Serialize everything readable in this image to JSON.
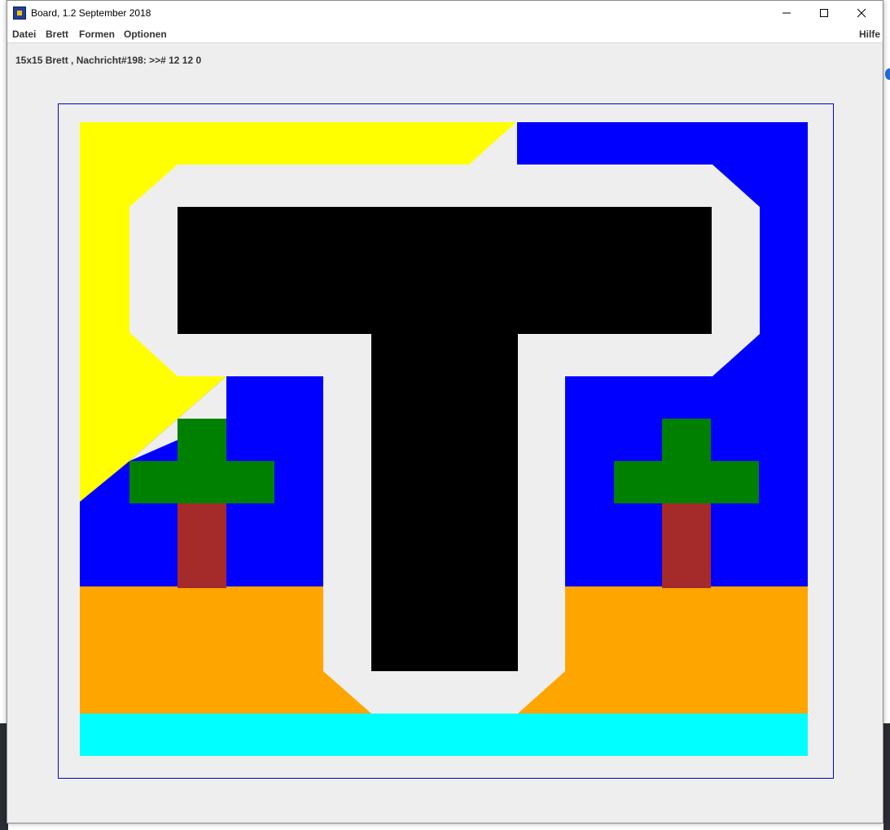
{
  "window": {
    "title": "Board, 1.2 September 2018",
    "icon": "board-app-icon",
    "controls": [
      "minimize-icon",
      "maximize-icon",
      "close-icon"
    ]
  },
  "menu": {
    "datei": "Datei",
    "brett": "Brett",
    "formen": "Formen",
    "optionen": "Optionen",
    "hilfe": "Hilfe"
  },
  "status": "15x15 Brett , Nachricht#198: >># 12 12 0",
  "board": {
    "size": "15x15",
    "colors": {
      "background": "#eeeeee",
      "yellow": "#ffff00",
      "blue": "#0000ff",
      "black": "#000000",
      "green": "#008000",
      "brown": "#a52a2a",
      "orange": "#ffa500",
      "cyan": "#00ffff",
      "frame": "#0000cc"
    }
  }
}
